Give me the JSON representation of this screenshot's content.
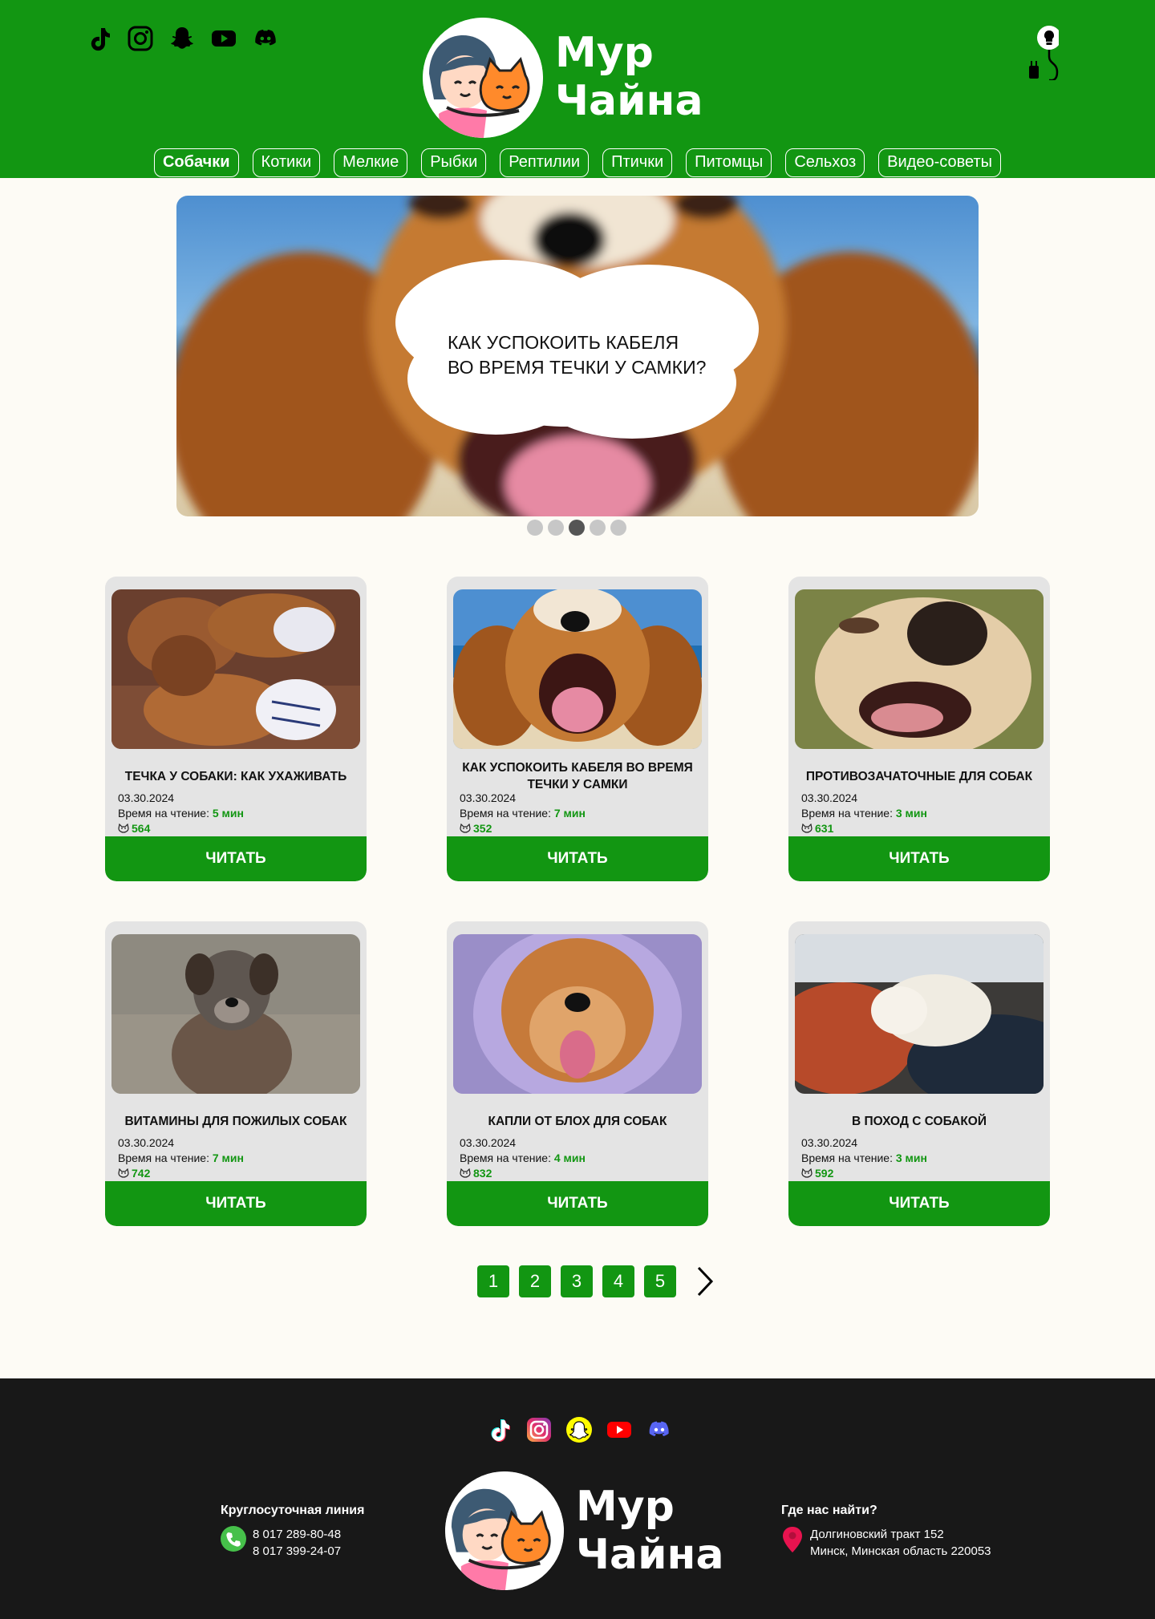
{
  "header": {
    "brand_line1": "Мур",
    "brand_line2": "Чайна",
    "social": [
      "tiktok-icon",
      "instagram-icon",
      "snapchat-icon",
      "youtube-icon",
      "discord-icon"
    ],
    "theme_toggle_icon": "lightbulb-icon"
  },
  "nav": {
    "items": [
      {
        "label": "Собачки",
        "active": true
      },
      {
        "label": "Котики"
      },
      {
        "label": "Мелкие"
      },
      {
        "label": "Рыбки"
      },
      {
        "label": "Рептилии"
      },
      {
        "label": "Птички"
      },
      {
        "label": "Питомцы"
      },
      {
        "label": "Сельхоз"
      },
      {
        "label": "Видео-советы"
      }
    ]
  },
  "hero": {
    "line1": "КАК УСПОКОИТЬ КАБЕЛЯ",
    "line2": "ВО ВРЕМЯ ТЕЧКИ У САМКИ?",
    "slides_count": 5,
    "active_slide": 3
  },
  "cards": [
    {
      "title": "ТЕЧКА У СОБАКИ: КАК УХАЖИВАТЬ",
      "date": "03.30.2024",
      "read_label": "Время на чтение:",
      "read_time": "5 мин",
      "views": "564",
      "button": "ЧИТАТЬ",
      "photo": "dogs-in-diapers"
    },
    {
      "title": "КАК УСПОКОИТЬ КАБЕЛЯ ВО ВРЕМЯ ТЕЧКИ У САМКИ",
      "date": "03.30.2024",
      "read_label": "Время на чтение:",
      "read_time": "7 мин",
      "views": "352",
      "button": "ЧИТАТЬ",
      "photo": "beagle-yawning"
    },
    {
      "title": "ПРОТИВОЗАЧАТОЧНЫЕ ДЛЯ СОБАК",
      "date": "03.30.2024",
      "read_label": "Время на чтение:",
      "read_time": "3 мин",
      "views": "631",
      "button": "ЧИТАТЬ",
      "photo": "dog-closeup-grass"
    },
    {
      "title": "ВИТАМИНЫ ДЛЯ ПОЖИЛЫХ СОБАК",
      "date": "03.30.2024",
      "read_label": "Время на чтение:",
      "read_time": "7 мин",
      "views": "742",
      "button": "ЧИТАТЬ",
      "photo": "old-dog"
    },
    {
      "title": "КАПЛИ ОТ БЛОХ ДЛЯ СОБАК",
      "date": "03.30.2024",
      "read_label": "Время на чтение:",
      "read_time": "4 мин",
      "views": "832",
      "button": "ЧИТАТЬ",
      "photo": "pomeranian-hoodie"
    },
    {
      "title": "В ПОХОД С СОБАКОЙ",
      "date": "03.30.2024",
      "read_label": "Время на чтение:",
      "read_time": "3 мин",
      "views": "592",
      "button": "ЧИТАТЬ",
      "photo": "puppy-sleeping-snow"
    }
  ],
  "pagination": {
    "pages": [
      "1",
      "2",
      "3",
      "4",
      "5"
    ],
    "next_icon": "chevron-right-icon"
  },
  "footer": {
    "social": [
      "tiktok-icon",
      "instagram-icon",
      "snapchat-icon",
      "youtube-icon",
      "discord-icon"
    ],
    "brand_line1": "Мур",
    "brand_line2": "Чайна",
    "hotline_title": "Круглосуточная линия",
    "phone1": "8 017 289-80-48",
    "phone2": "8 017 399-24-07",
    "address_title": "Где нас найти?",
    "address1": "Долгиновский тракт 152",
    "address2": "Минск, Минская область 220053"
  },
  "colors": {
    "brand_green": "#129612",
    "page_bg": "#fdfbf5",
    "card_bg": "#e4e4e4",
    "footer_bg": "#181818"
  }
}
